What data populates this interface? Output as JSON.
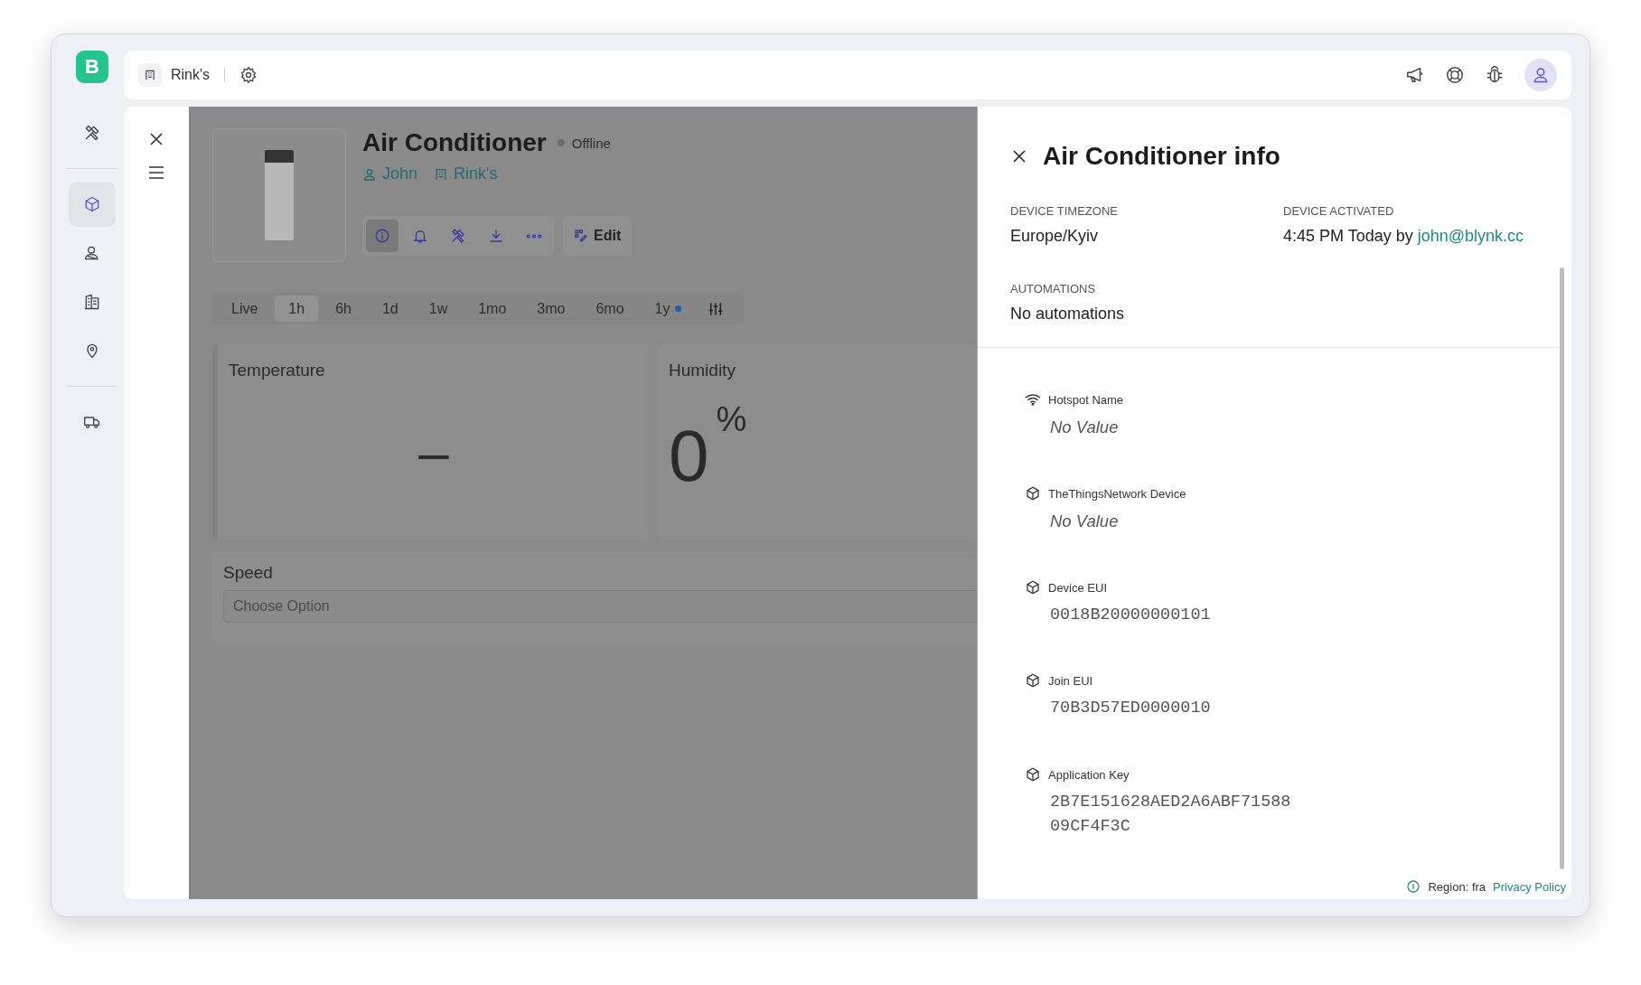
{
  "app": {
    "logo": "B"
  },
  "sidebar": {
    "items": [
      {
        "selected": false
      },
      {
        "selected": true
      },
      {
        "selected": false
      },
      {
        "selected": false
      },
      {
        "selected": false
      },
      {
        "selected": false
      }
    ]
  },
  "topbar": {
    "organization": "Rink's"
  },
  "device": {
    "title": "Air Conditioner",
    "status": "Offline",
    "owner": "John",
    "location": "Rink's",
    "actions": [
      {
        "selected": true
      },
      {
        "selected": false
      },
      {
        "selected": false
      },
      {
        "selected": false
      },
      {
        "selected": false
      }
    ],
    "edit_button": "Edit",
    "time_ranges": [
      {
        "label": "Live",
        "selected": false,
        "dot": false
      },
      {
        "label": "1h",
        "selected": true,
        "dot": false
      },
      {
        "label": "6h",
        "selected": false,
        "dot": false
      },
      {
        "label": "1d",
        "selected": false,
        "dot": false
      },
      {
        "label": "1w",
        "selected": false,
        "dot": false
      },
      {
        "label": "1mo",
        "selected": false,
        "dot": false
      },
      {
        "label": "3mo",
        "selected": false,
        "dot": false
      },
      {
        "label": "6mo",
        "selected": false,
        "dot": false
      },
      {
        "label": "1y",
        "selected": false,
        "dot": true
      }
    ],
    "widgets": [
      {
        "title": "Temperature",
        "value": "–"
      },
      {
        "title": "Humidity",
        "value": "0",
        "unit": "%"
      }
    ],
    "speed": {
      "title": "Speed",
      "placeholder": "Choose Option"
    }
  },
  "info_panel": {
    "title": "Air Conditioner info",
    "timezone": {
      "label": "DEVICE TIMEZONE",
      "value": "Europe/Kyiv"
    },
    "activated": {
      "label": "DEVICE ACTIVATED",
      "value": "4:45 PM Today by ",
      "link": "john@blynk.cc"
    },
    "automations": {
      "label": "AUTOMATIONS",
      "value": "No automations"
    },
    "datastreams": [
      {
        "kind": "wifi",
        "label": "Hotspot Name",
        "value": "No Value",
        "empty": true
      },
      {
        "kind": "device",
        "label": "TheThingsNetwork Device",
        "value": "No Value",
        "empty": true
      },
      {
        "kind": "device",
        "label": "Device EUI",
        "value": "0018B20000000101",
        "empty": false
      },
      {
        "kind": "device",
        "label": "Join EUI",
        "value": "70B3D57ED0000010",
        "empty": false
      },
      {
        "kind": "device",
        "label": "Application Key",
        "value": "2B7E151628AED2A6ABF7158809CF4F3C",
        "empty": false
      }
    ]
  },
  "footer": {
    "region": "Region: fra",
    "link": "Privacy Policy"
  }
}
